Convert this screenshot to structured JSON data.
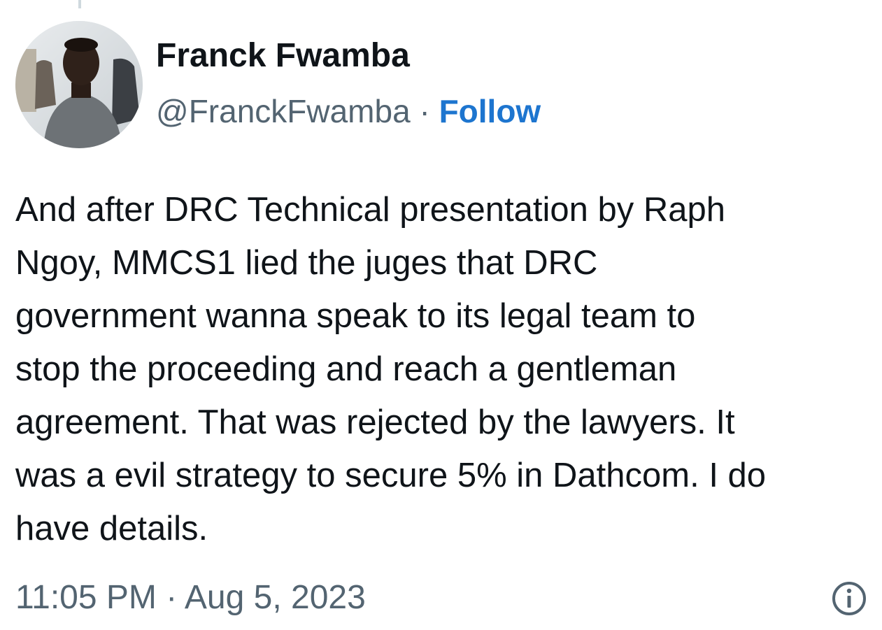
{
  "tweet": {
    "author": {
      "display_name": "Franck Fwamba",
      "handle": "@FranckFwamba",
      "separator": "·",
      "follow_label": "Follow"
    },
    "text": "And after DRC Technical presentation by Raph\nNgoy, MMCS1 lied the juges that DRC\ngovernment wanna speak to its legal team to\nstop the proceeding and reach a gentleman\nagreement. That was rejected by the lawyers. It\nwas a evil strategy to secure 5% in Dathcom. I do\nhave details.",
    "timestamp": "11:05 PM · Aug 5, 2023",
    "icons": {
      "info": "info-icon",
      "avatar": "avatar-photo"
    }
  },
  "colors": {
    "text_primary": "#0f1419",
    "text_secondary": "#536471",
    "link_blue": "#1d75cf"
  }
}
